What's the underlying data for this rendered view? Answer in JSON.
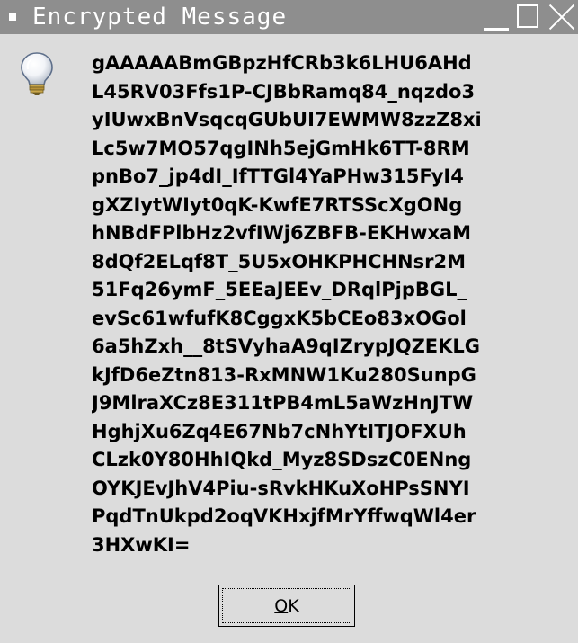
{
  "window": {
    "title": "Encrypted Message",
    "controls": {
      "minimize_icon": "minimize-icon",
      "maximize_icon": "maximize-icon",
      "close_icon": "close-icon"
    }
  },
  "dialog": {
    "icon": "lightbulb-icon",
    "message_lines": [
      "gAAAAABmGBpzHfCRb3k6LHU6AHd",
      "L45RV03Ffs1P-CJBbRamq84_nqzdo3",
      "yIUwxBnVsqcqGUbUI7EWMW8zzZ8xi",
      "Lc5w7MO57qgINh5ejGmHk6TT-8RM",
      "pnBo7_jp4dI_IfTTGl4YaPHw315FyI4",
      "gXZIytWIyt0qK-KwfE7RTSScXgONg",
      "hNBdFPlbHz2vfIWj6ZBFB-EKHwxaM",
      "8dQf2ELqf8T_5U5xOHKPHCHNsr2M",
      "51Fq26ymF_5EEaJEEv_DRqlPjpBGL_",
      "evSc61wfufK8CggxK5bCEo83xOGol",
      "6a5hZxh__8tSVyhaA9qIZrypJQZEKLG",
      "kJfD6eZtn813-RxMNW1Ku280SunpG",
      "J9MlraXCz8E311tPB4mL5aWzHnJTW",
      "HghjXu6Zq4E67Nb7cNhYtITJOFXUh",
      "CLzk0Y80HhIQkd_Myz8SDszC0ENng",
      "OYKJEvJhV4Piu-sRvkHKuXoHPsSNYI",
      "PqdTnUkpd2oqVKHxjfMrYffwqWl4er",
      "3HXwKI="
    ],
    "ok_button": {
      "label_mnemonic": "O",
      "label_rest": "K"
    }
  },
  "colors": {
    "titlebar": "#8e8e8e",
    "background": "#dcdcdc",
    "text": "#000000"
  }
}
